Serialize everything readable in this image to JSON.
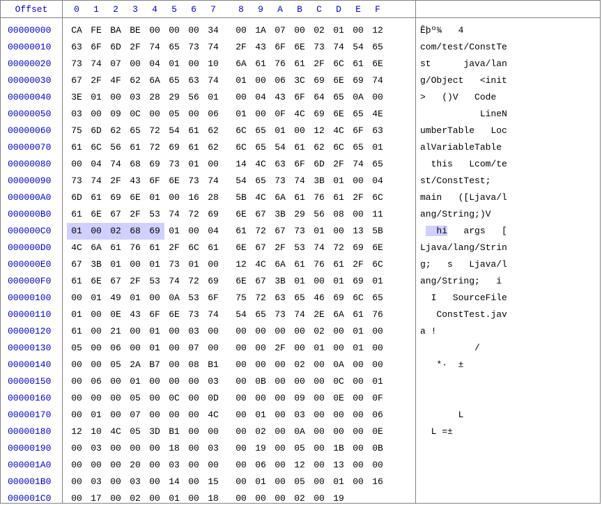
{
  "header": {
    "offset_label": "Offset",
    "cols": [
      "0",
      "1",
      "2",
      "3",
      "4",
      "5",
      "6",
      "7",
      "8",
      "9",
      "A",
      "B",
      "C",
      "D",
      "E",
      "F"
    ]
  },
  "highlight": {
    "row": 12,
    "start": 0,
    "end": 4,
    "ascii_start": 1,
    "ascii_end": 5
  },
  "rows": [
    {
      "offset": "00000000",
      "hex": [
        "CA",
        "FE",
        "BA",
        "BE",
        "00",
        "00",
        "00",
        "34",
        "00",
        "1A",
        "07",
        "00",
        "02",
        "01",
        "00",
        "12"
      ],
      "ascii": "Êþº¾   4        "
    },
    {
      "offset": "00000010",
      "hex": [
        "63",
        "6F",
        "6D",
        "2F",
        "74",
        "65",
        "73",
        "74",
        "2F",
        "43",
        "6F",
        "6E",
        "73",
        "74",
        "54",
        "65"
      ],
      "ascii": "com/test/ConstTe"
    },
    {
      "offset": "00000020",
      "hex": [
        "73",
        "74",
        "07",
        "00",
        "04",
        "01",
        "00",
        "10",
        "6A",
        "61",
        "76",
        "61",
        "2F",
        "6C",
        "61",
        "6E"
      ],
      "ascii": "st      java/lan"
    },
    {
      "offset": "00000030",
      "hex": [
        "67",
        "2F",
        "4F",
        "62",
        "6A",
        "65",
        "63",
        "74",
        "01",
        "00",
        "06",
        "3C",
        "69",
        "6E",
        "69",
        "74"
      ],
      "ascii": "g/Object   <init"
    },
    {
      "offset": "00000040",
      "hex": [
        "3E",
        "01",
        "00",
        "03",
        "28",
        "29",
        "56",
        "01",
        "00",
        "04",
        "43",
        "6F",
        "64",
        "65",
        "0A",
        "00"
      ],
      "ascii": ">   ()V   Code  "
    },
    {
      "offset": "00000050",
      "hex": [
        "03",
        "00",
        "09",
        "0C",
        "00",
        "05",
        "00",
        "06",
        "01",
        "00",
        "0F",
        "4C",
        "69",
        "6E",
        "65",
        "4E"
      ],
      "ascii": "           LineN"
    },
    {
      "offset": "00000060",
      "hex": [
        "75",
        "6D",
        "62",
        "65",
        "72",
        "54",
        "61",
        "62",
        "6C",
        "65",
        "01",
        "00",
        "12",
        "4C",
        "6F",
        "63"
      ],
      "ascii": "umberTable   Loc"
    },
    {
      "offset": "00000070",
      "hex": [
        "61",
        "6C",
        "56",
        "61",
        "72",
        "69",
        "61",
        "62",
        "6C",
        "65",
        "54",
        "61",
        "62",
        "6C",
        "65",
        "01"
      ],
      "ascii": "alVariableTable "
    },
    {
      "offset": "00000080",
      "hex": [
        "00",
        "04",
        "74",
        "68",
        "69",
        "73",
        "01",
        "00",
        "14",
        "4C",
        "63",
        "6F",
        "6D",
        "2F",
        "74",
        "65"
      ],
      "ascii": "  this   Lcom/te"
    },
    {
      "offset": "00000090",
      "hex": [
        "73",
        "74",
        "2F",
        "43",
        "6F",
        "6E",
        "73",
        "74",
        "54",
        "65",
        "73",
        "74",
        "3B",
        "01",
        "00",
        "04"
      ],
      "ascii": "st/ConstTest;   "
    },
    {
      "offset": "000000A0",
      "hex": [
        "6D",
        "61",
        "69",
        "6E",
        "01",
        "00",
        "16",
        "28",
        "5B",
        "4C",
        "6A",
        "61",
        "76",
        "61",
        "2F",
        "6C"
      ],
      "ascii": "main   ([Ljava/l"
    },
    {
      "offset": "000000B0",
      "hex": [
        "61",
        "6E",
        "67",
        "2F",
        "53",
        "74",
        "72",
        "69",
        "6E",
        "67",
        "3B",
        "29",
        "56",
        "08",
        "00",
        "11"
      ],
      "ascii": "ang/String;)V   "
    },
    {
      "offset": "000000C0",
      "hex": [
        "01",
        "00",
        "02",
        "68",
        "69",
        "01",
        "00",
        "04",
        "61",
        "72",
        "67",
        "73",
        "01",
        "00",
        "13",
        "5B"
      ],
      "ascii": "   hi   args   ["
    },
    {
      "offset": "000000D0",
      "hex": [
        "4C",
        "6A",
        "61",
        "76",
        "61",
        "2F",
        "6C",
        "61",
        "6E",
        "67",
        "2F",
        "53",
        "74",
        "72",
        "69",
        "6E"
      ],
      "ascii": "Ljava/lang/Strin"
    },
    {
      "offset": "000000E0",
      "hex": [
        "67",
        "3B",
        "01",
        "00",
        "01",
        "73",
        "01",
        "00",
        "12",
        "4C",
        "6A",
        "61",
        "76",
        "61",
        "2F",
        "6C"
      ],
      "ascii": "g;   s   Ljava/l"
    },
    {
      "offset": "000000F0",
      "hex": [
        "61",
        "6E",
        "67",
        "2F",
        "53",
        "74",
        "72",
        "69",
        "6E",
        "67",
        "3B",
        "01",
        "00",
        "01",
        "69",
        "01"
      ],
      "ascii": "ang/String;   i "
    },
    {
      "offset": "00000100",
      "hex": [
        "00",
        "01",
        "49",
        "01",
        "00",
        "0A",
        "53",
        "6F",
        "75",
        "72",
        "63",
        "65",
        "46",
        "69",
        "6C",
        "65"
      ],
      "ascii": "  I   SourceFile"
    },
    {
      "offset": "00000110",
      "hex": [
        "01",
        "00",
        "0E",
        "43",
        "6F",
        "6E",
        "73",
        "74",
        "54",
        "65",
        "73",
        "74",
        "2E",
        "6A",
        "61",
        "76"
      ],
      "ascii": "   ConstTest.jav"
    },
    {
      "offset": "00000120",
      "hex": [
        "61",
        "00",
        "21",
        "00",
        "01",
        "00",
        "03",
        "00",
        "00",
        "00",
        "00",
        "00",
        "02",
        "00",
        "01",
        "00"
      ],
      "ascii": "a !             "
    },
    {
      "offset": "00000130",
      "hex": [
        "05",
        "00",
        "06",
        "00",
        "01",
        "00",
        "07",
        "00",
        "00",
        "00",
        "2F",
        "00",
        "01",
        "00",
        "01",
        "00"
      ],
      "ascii": "          /     "
    },
    {
      "offset": "00000140",
      "hex": [
        "00",
        "00",
        "05",
        "2A",
        "B7",
        "00",
        "08",
        "B1",
        "00",
        "00",
        "00",
        "02",
        "00",
        "0A",
        "00",
        "00"
      ],
      "ascii": "   *·  ±        "
    },
    {
      "offset": "00000150",
      "hex": [
        "00",
        "06",
        "00",
        "01",
        "00",
        "00",
        "00",
        "03",
        "00",
        "0B",
        "00",
        "00",
        "00",
        "0C",
        "00",
        "01"
      ],
      "ascii": "                "
    },
    {
      "offset": "00000160",
      "hex": [
        "00",
        "00",
        "00",
        "05",
        "00",
        "0C",
        "00",
        "0D",
        "00",
        "00",
        "00",
        "09",
        "00",
        "0E",
        "00",
        "0F"
      ],
      "ascii": "                "
    },
    {
      "offset": "00000170",
      "hex": [
        "00",
        "01",
        "00",
        "07",
        "00",
        "00",
        "00",
        "4C",
        "00",
        "01",
        "00",
        "03",
        "00",
        "00",
        "00",
        "06"
      ],
      "ascii": "       L        "
    },
    {
      "offset": "00000180",
      "hex": [
        "12",
        "10",
        "4C",
        "05",
        "3D",
        "B1",
        "00",
        "00",
        "00",
        "02",
        "00",
        "0A",
        "00",
        "00",
        "00",
        "0E"
      ],
      "ascii": "  L =±          "
    },
    {
      "offset": "00000190",
      "hex": [
        "00",
        "03",
        "00",
        "00",
        "00",
        "18",
        "00",
        "03",
        "00",
        "19",
        "00",
        "05",
        "00",
        "1B",
        "00",
        "0B"
      ],
      "ascii": "                "
    },
    {
      "offset": "000001A0",
      "hex": [
        "00",
        "00",
        "00",
        "20",
        "00",
        "03",
        "00",
        "00",
        "00",
        "06",
        "00",
        "12",
        "00",
        "13",
        "00",
        "00"
      ],
      "ascii": "                "
    },
    {
      "offset": "000001B0",
      "hex": [
        "00",
        "03",
        "00",
        "03",
        "00",
        "14",
        "00",
        "15",
        "00",
        "01",
        "00",
        "05",
        "00",
        "01",
        "00",
        "16"
      ],
      "ascii": "                "
    },
    {
      "offset": "000001C0",
      "hex": [
        "00",
        "17",
        "00",
        "02",
        "00",
        "01",
        "00",
        "18",
        "00",
        "00",
        "00",
        "02",
        "00",
        "19"
      ],
      "ascii": "              "
    }
  ]
}
